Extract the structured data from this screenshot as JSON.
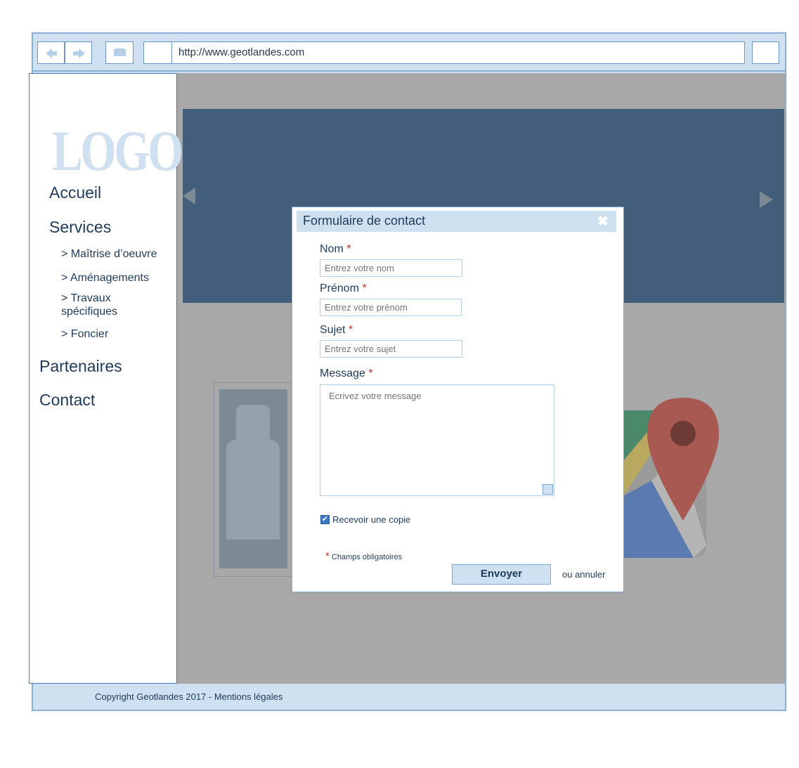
{
  "browser": {
    "url": "http://www.geotlandes.com"
  },
  "sidebar": {
    "logo": "LOGO",
    "menu": [
      {
        "label": "Accueil"
      },
      {
        "label": "Services"
      },
      {
        "label": "Partenaires"
      },
      {
        "label": "Contact"
      }
    ],
    "services_sub": [
      {
        "label": "> Maîtrise d’oeuvre"
      },
      {
        "label": "> Aménagements"
      },
      {
        "label": "> Travaux spécifiques"
      },
      {
        "label": "> Foncier"
      }
    ]
  },
  "footer": {
    "copyright": "Copyright Geotlandes 2017 - Mentions légales"
  },
  "modal": {
    "title": "Formulaire de contact",
    "close_icon": "close-icon",
    "required_mark": "*",
    "fields": {
      "nom": {
        "label": "Nom",
        "placeholder": "Entrez votre nom"
      },
      "prenom": {
        "label": "Prénom",
        "placeholder": "Entrez votre prénom"
      },
      "sujet": {
        "label": "Sujet",
        "placeholder": "Entrez votre sujet"
      },
      "message": {
        "label": "Message",
        "placeholder": "Ecrivez votre message"
      }
    },
    "copy_checkbox": {
      "label": "Recevoir une copie",
      "checked": true
    },
    "required_note": "Champs obligatoires",
    "submit_label": "Envoyer",
    "cancel_label": "ou annuler"
  },
  "colors": {
    "chrome": "#cfe0f0",
    "border": "#3d78c4",
    "banner": "#425e7a",
    "overlay": "#a8a8a8",
    "text": "#1f3b5a",
    "required": "#d0302a"
  }
}
